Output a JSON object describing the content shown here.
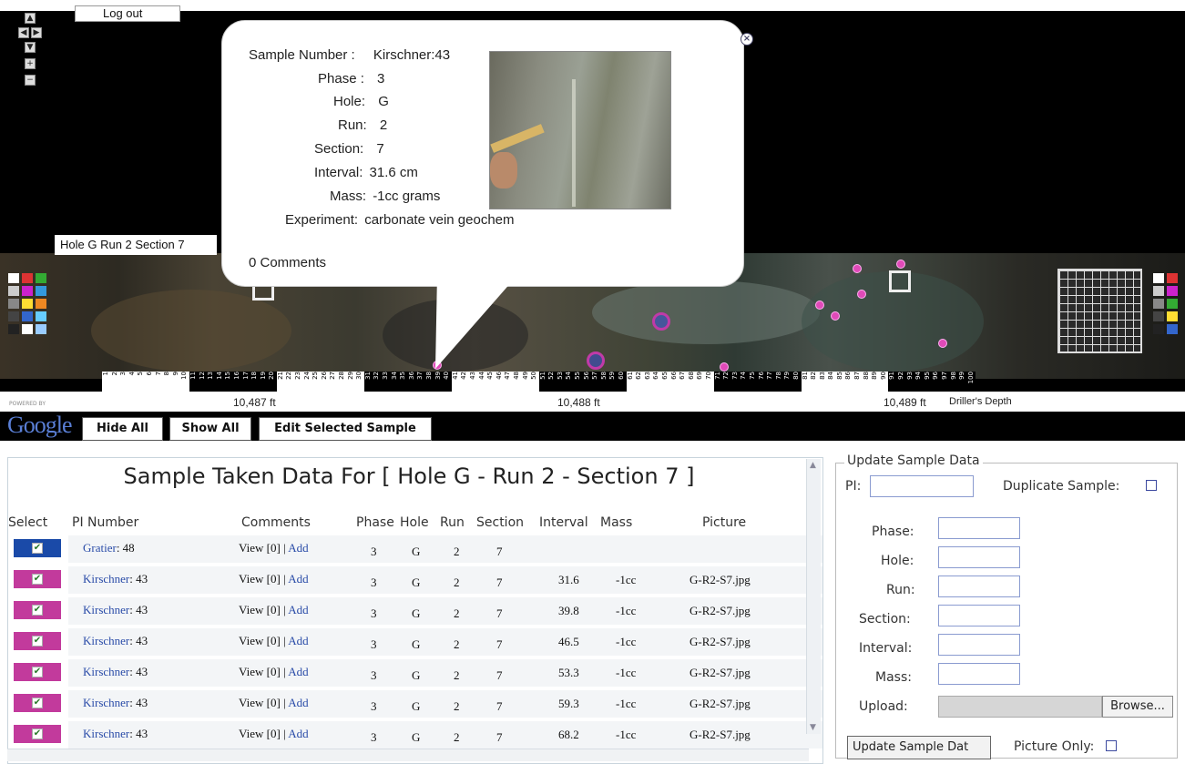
{
  "header": {
    "logout_label": "Log out",
    "hole_label": "Hole G Run 2 Section 7",
    "nav_controls": [
      "up-arrow",
      "left-arrow",
      "right-arrow",
      "down-arrow",
      "zoom-in",
      "zoom-out"
    ]
  },
  "popup": {
    "sample_number_label": "Sample Number :",
    "sample_number_value": "Kirschner:43",
    "phase_label": "Phase :",
    "phase_value": "3",
    "hole_label": "Hole:",
    "hole_value": "G",
    "run_label": "Run:",
    "run_value": "2",
    "section_label": "Section:",
    "section_value": "7",
    "interval_label": "Interval:",
    "interval_value": "31.6 cm",
    "mass_label": "Mass:",
    "mass_value": "-1cc grams",
    "experiment_label": "Experiment:",
    "experiment_value": "carbonate vein geochem",
    "comments_label": "0 Comments",
    "close_icon": "close-icon"
  },
  "depth_scale": {
    "depth1": "10,487 ft",
    "depth2": "10,488 ft",
    "depth3": "10,489 ft",
    "depth_caption": "Driller's Depth",
    "ruler_numbers": [
      "1",
      "2",
      "3",
      "4",
      "5",
      "6",
      "7",
      "8",
      "9",
      "10",
      "11",
      "12",
      "13",
      "14",
      "15",
      "16",
      "17",
      "18",
      "19",
      "20",
      "21",
      "22",
      "23",
      "24",
      "25",
      "26",
      "27",
      "28",
      "29",
      "30",
      "31",
      "32",
      "33",
      "34",
      "35",
      "36",
      "37",
      "38",
      "39",
      "40",
      "41",
      "42",
      "43",
      "44",
      "45",
      "46",
      "47",
      "48",
      "49",
      "50",
      "51",
      "52",
      "53",
      "54",
      "55",
      "56",
      "57",
      "58",
      "59",
      "60",
      "61",
      "62",
      "63",
      "64",
      "65",
      "66",
      "67",
      "68",
      "69",
      "70",
      "71",
      "72",
      "73",
      "74",
      "75",
      "76",
      "77",
      "78",
      "79",
      "80",
      "81",
      "82",
      "83",
      "84",
      "85",
      "86",
      "87",
      "88",
      "89",
      "90",
      "91",
      "92",
      "93",
      "94",
      "95",
      "96",
      "97",
      "98",
      "99",
      "100"
    ]
  },
  "toolbar": {
    "powered_by": "POWERED BY",
    "google_logo": "Google",
    "hide_all": "Hide All",
    "show_all": "Show All",
    "edit_selected": "Edit Selected Sample"
  },
  "table": {
    "title": "Sample Taken Data For [ Hole G - Run 2 - Section 7 ]",
    "headers": {
      "select": "Select",
      "pi_number": "PI Number",
      "comments": "Comments",
      "phase": "Phase",
      "hole": "Hole",
      "run": "Run",
      "section": "Section",
      "interval": "Interval",
      "mass": "Mass",
      "picture": "Picture"
    },
    "rows": [
      {
        "pi_name": "Gratier",
        "pi_num": ": 48",
        "view": "View [0]",
        "sep": " | ",
        "add": "Add",
        "phase": "3",
        "hole": "G",
        "run": "2",
        "section": "7",
        "interval": "",
        "mass": "",
        "picture": "",
        "color": "#1a4aa8"
      },
      {
        "pi_name": "Kirschner",
        "pi_num": ": 43",
        "view": "View [0]",
        "sep": " | ",
        "add": "Add",
        "phase": "3",
        "hole": "G",
        "run": "2",
        "section": "7",
        "interval": "31.6",
        "mass": "-1cc",
        "picture": "G-R2-S7.jpg",
        "color": "#c23a9c"
      },
      {
        "pi_name": "Kirschner",
        "pi_num": ": 43",
        "view": "View [0]",
        "sep": " | ",
        "add": "Add",
        "phase": "3",
        "hole": "G",
        "run": "2",
        "section": "7",
        "interval": "39.8",
        "mass": "-1cc",
        "picture": "G-R2-S7.jpg",
        "color": "#c23a9c"
      },
      {
        "pi_name": "Kirschner",
        "pi_num": ": 43",
        "view": "View [0]",
        "sep": " | ",
        "add": "Add",
        "phase": "3",
        "hole": "G",
        "run": "2",
        "section": "7",
        "interval": "46.5",
        "mass": "-1cc",
        "picture": "G-R2-S7.jpg",
        "color": "#c23a9c"
      },
      {
        "pi_name": "Kirschner",
        "pi_num": ": 43",
        "view": "View [0]",
        "sep": " | ",
        "add": "Add",
        "phase": "3",
        "hole": "G",
        "run": "2",
        "section": "7",
        "interval": "53.3",
        "mass": "-1cc",
        "picture": "G-R2-S7.jpg",
        "color": "#c23a9c"
      },
      {
        "pi_name": "Kirschner",
        "pi_num": ": 43",
        "view": "View [0]",
        "sep": " | ",
        "add": "Add",
        "phase": "3",
        "hole": "G",
        "run": "2",
        "section": "7",
        "interval": "59.3",
        "mass": "-1cc",
        "picture": "G-R2-S7.jpg",
        "color": "#c23a9c"
      },
      {
        "pi_name": "Kirschner",
        "pi_num": ": 43",
        "view": "View [0]",
        "sep": " | ",
        "add": "Add",
        "phase": "3",
        "hole": "G",
        "run": "2",
        "section": "7",
        "interval": "68.2",
        "mass": "-1cc",
        "picture": "G-R2-S7.jpg",
        "color": "#c23a9c"
      }
    ]
  },
  "update_form": {
    "legend": "Update Sample Data",
    "pi_label": "PI:",
    "pi_value": "",
    "duplicate_label": "Duplicate Sample:",
    "phase_label": "Phase:",
    "hole_label": "Hole:",
    "run_label": "Run:",
    "section_label": "Section:",
    "interval_label": "Interval:",
    "mass_label": "Mass:",
    "upload_label": "Upload:",
    "browse_label": "Browse...",
    "update_button": "Update Sample Dat",
    "picture_only_label": "Picture Only:"
  },
  "colors": {
    "select_blue": "#1a4aa8",
    "select_magenta": "#c23a9c",
    "marker_pink": "#e04ab8",
    "link_blue": "#2a4ca8"
  }
}
